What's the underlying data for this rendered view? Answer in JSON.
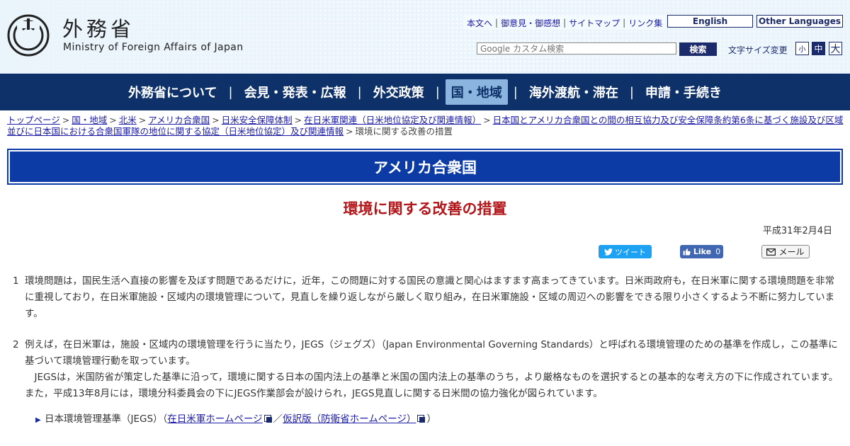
{
  "header": {
    "title_ja": "外務省",
    "title_en": "Ministry of Foreign Affairs of Japan",
    "utility_links": [
      "本文へ",
      "御意見・御感想",
      "サイトマップ",
      "リンク集"
    ],
    "english_label": "English",
    "other_languages_label": "Other Languages",
    "search_placeholder": "Google カスタム検索",
    "search_button": "検索",
    "font_size_label": "文字サイズ変更",
    "font_sizes": [
      "小",
      "中",
      "大"
    ]
  },
  "nav": {
    "items": [
      "外務省について",
      "会見・発表・広報",
      "外交政策",
      "国・地域",
      "海外渡航・滞在",
      "申請・手続き"
    ],
    "active": "国・地域"
  },
  "breadcrumb": {
    "links": [
      "トップページ",
      "国・地域",
      "北米",
      "アメリカ合衆国",
      "日米安全保障体制",
      "在日米軍関連（日米地位協定及び関連情報）",
      "日本国とアメリカ合衆国との間の相互協力及び安全保障条約第6条に基づく施設及び区域並びに日本国における合衆国軍隊の地位に関する協定（日米地位協定）及び関連情報"
    ],
    "current": "環境に関する改善の措置"
  },
  "section_title": "アメリカ合衆国",
  "page_title": "環境に関する改善の措置",
  "date": "平成31年2月4日",
  "share": {
    "tweet": "ツイート",
    "like": "Like",
    "like_count": "0",
    "mail": "メール"
  },
  "content": {
    "p1_num": "1",
    "p1": "環境問題は，国民生活へ直接の影響を及ぼす問題であるだけに，近年，この問題に対する国民の意識と関心はますます高まってきています。日米両政府も，在日米軍に関する環境問題を非常に重視しており，在日米軍施設・区域内の環境管理について，見直しを繰り返しながら厳しく取り組み，在日米軍施設・区域の周辺への影響をできる限り小さくするよう不断に努力しています。",
    "p2_num": "2",
    "p2a": "例えば，在日米軍は，施設・区域内の環境管理を行うに当たり，JEGS（ジェグズ）（Japan Environmental Governing Standards）と呼ばれる環境管理のための基準を作成し，この基準に基づいて環境管理行動を取っています。",
    "p2b": "JEGSは，米国防省が策定した基準に沿って，環境に関する日本の国内法上の基準と米国の国内法上の基準のうち，より厳格なものを選択するとの基本的な考え方の下に作成されています。また，平成13年8月には，環境分科委員会の下にJEGS作業部会が設けられ，JEGS見直しに関する日米間の協力強化が図られています。",
    "link_item_label": "日本環境管理基準（JEGS）（",
    "link1": "在日米軍ホームページ",
    "link_sep": "／",
    "link2": "仮訳版（防衛省ホームページ）",
    "link_close": "）"
  }
}
